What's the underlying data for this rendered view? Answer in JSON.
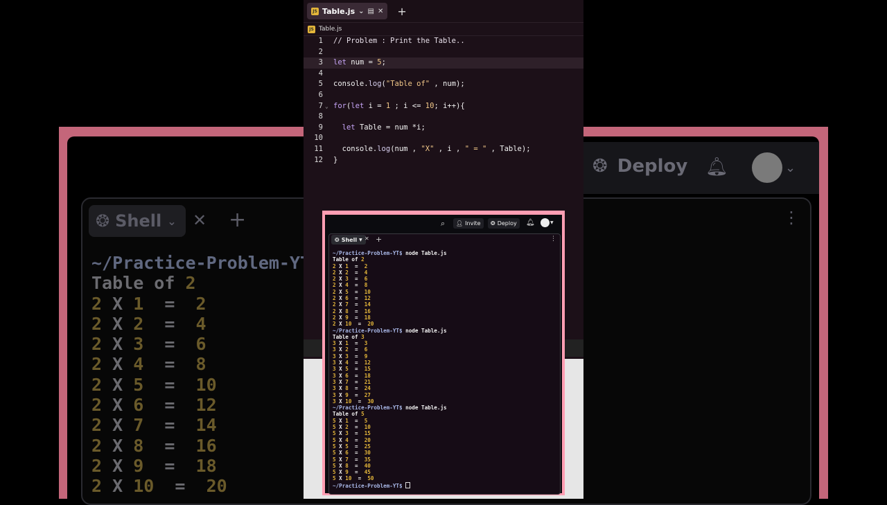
{
  "editor": {
    "tab_label": "Table.js",
    "breadcrumb": "Table.js",
    "code": [
      {
        "n": "1",
        "html": "<span class=\"c-com\">// Problem : Print the Table..</span>"
      },
      {
        "n": "2",
        "html": ""
      },
      {
        "n": "3",
        "html": "<span class=\"c-kw\">let</span> num = <span class=\"c-num\">5</span>;",
        "active": true
      },
      {
        "n": "4",
        "html": ""
      },
      {
        "n": "5",
        "html": "console.<span class=\"c-fn\">log</span>(<span class=\"c-str\">\"Table of\"</span> , num);"
      },
      {
        "n": "6",
        "html": ""
      },
      {
        "n": "7",
        "html": "<span class=\"c-kw\">for</span>(<span class=\"c-kw\">let</span> i = <span class=\"c-num\">1</span> ; i &lt;= <span class=\"c-num\">10</span>; i++){",
        "fold": true
      },
      {
        "n": "8",
        "html": ""
      },
      {
        "n": "9",
        "html": "  <span class=\"c-kw\">let</span> Table = num *i;"
      },
      {
        "n": "10",
        "html": ""
      },
      {
        "n": "11",
        "html": "  console.<span class=\"c-fn\">log</span>(num , <span class=\"c-str\">\"X\"</span> , i , <span class=\"c-str\">\" = \"</span> , Table);"
      },
      {
        "n": "12",
        "html": "}"
      }
    ]
  },
  "header": {
    "invite_label": "Invite",
    "deploy_label": "Deploy"
  },
  "shell": {
    "tab_label": "Shell",
    "prompt": "~/Practice-Problem-YT$",
    "command": "node Table.js",
    "runs": [
      {
        "label": "Table of",
        "num": "2",
        "rows": [
          [
            "2",
            "1",
            "2"
          ],
          [
            "2",
            "2",
            "4"
          ],
          [
            "2",
            "3",
            "6"
          ],
          [
            "2",
            "4",
            "8"
          ],
          [
            "2",
            "5",
            "10"
          ],
          [
            "2",
            "6",
            "12"
          ],
          [
            "2",
            "7",
            "14"
          ],
          [
            "2",
            "8",
            "16"
          ],
          [
            "2",
            "9",
            "18"
          ],
          [
            "2",
            "10",
            "20"
          ]
        ]
      },
      {
        "label": "Table of",
        "num": "3",
        "rows": [
          [
            "3",
            "1",
            "3"
          ],
          [
            "3",
            "2",
            "6"
          ],
          [
            "3",
            "3",
            "9"
          ],
          [
            "3",
            "4",
            "12"
          ],
          [
            "3",
            "5",
            "15"
          ],
          [
            "3",
            "6",
            "18"
          ],
          [
            "3",
            "7",
            "21"
          ],
          [
            "3",
            "8",
            "24"
          ],
          [
            "3",
            "9",
            "27"
          ],
          [
            "3",
            "10",
            "30"
          ]
        ]
      },
      {
        "label": "Table of",
        "num": "5",
        "rows": [
          [
            "5",
            "1",
            "5"
          ],
          [
            "5",
            "2",
            "10"
          ],
          [
            "5",
            "3",
            "15"
          ],
          [
            "5",
            "4",
            "20"
          ],
          [
            "5",
            "5",
            "25"
          ],
          [
            "5",
            "6",
            "30"
          ],
          [
            "5",
            "7",
            "35"
          ],
          [
            "5",
            "8",
            "40"
          ],
          [
            "5",
            "9",
            "45"
          ],
          [
            "5",
            "10",
            "50"
          ]
        ]
      }
    ]
  },
  "background": {
    "deploy_label": "Deploy",
    "shell_label": "Shell",
    "prompt": "~/Practice-Problem-YT",
    "table_label": "Table of",
    "num": "2",
    "rows": [
      [
        "2",
        "1",
        "2"
      ],
      [
        "2",
        "2",
        "4"
      ],
      [
        "2",
        "3",
        "6"
      ],
      [
        "2",
        "4",
        "8"
      ],
      [
        "2",
        "5",
        "10"
      ],
      [
        "2",
        "6",
        "12"
      ],
      [
        "2",
        "7",
        "14"
      ],
      [
        "2",
        "8",
        "16"
      ],
      [
        "2",
        "9",
        "18"
      ],
      [
        "2",
        "10",
        "20"
      ]
    ]
  },
  "icons": {
    "search": "search-icon",
    "invite": "user-plus-icon",
    "deploy": "rocket-icon",
    "bell": "bell-icon",
    "shell": "shell-icon",
    "close": "close-icon",
    "add": "plus-icon",
    "more": "more-vertical-icon",
    "js": "js-file-icon"
  }
}
